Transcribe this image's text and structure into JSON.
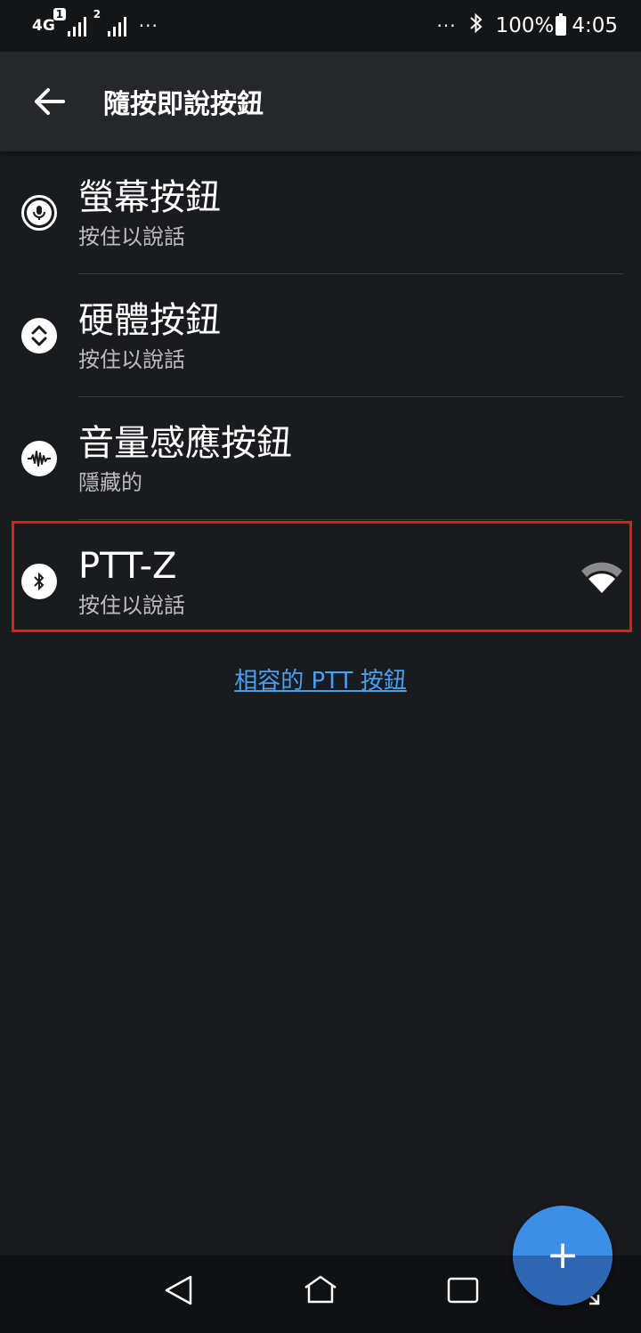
{
  "status_bar": {
    "network": "4G",
    "sim1_badge": "1",
    "sim2_badge": "2",
    "left_more": "···",
    "right_more": "···",
    "battery": "100%",
    "time": "4:05"
  },
  "app_bar": {
    "title": "隨按即說按鈕"
  },
  "items": [
    {
      "title": "螢幕按鈕",
      "subtitle": "按住以說話",
      "icon": "mic-icon"
    },
    {
      "title": "硬體按鈕",
      "subtitle": "按住以說話",
      "icon": "updown-chevron-icon"
    },
    {
      "title": "音量感應按鈕",
      "subtitle": "隱藏的",
      "icon": "waveform-icon"
    },
    {
      "title": "PTT-Z",
      "subtitle": "按住以說話",
      "icon": "bluetooth-icon",
      "status_icon": "wifi-signal-icon"
    }
  ],
  "compat_link": "相容的 PTT 按鈕",
  "fab": {
    "label": "+"
  },
  "colors": {
    "background": "#1a1b1e",
    "app_bar": "#26272b",
    "link": "#4a9ff0",
    "fab": "#3d8ee6",
    "highlight": "#e31b23"
  }
}
